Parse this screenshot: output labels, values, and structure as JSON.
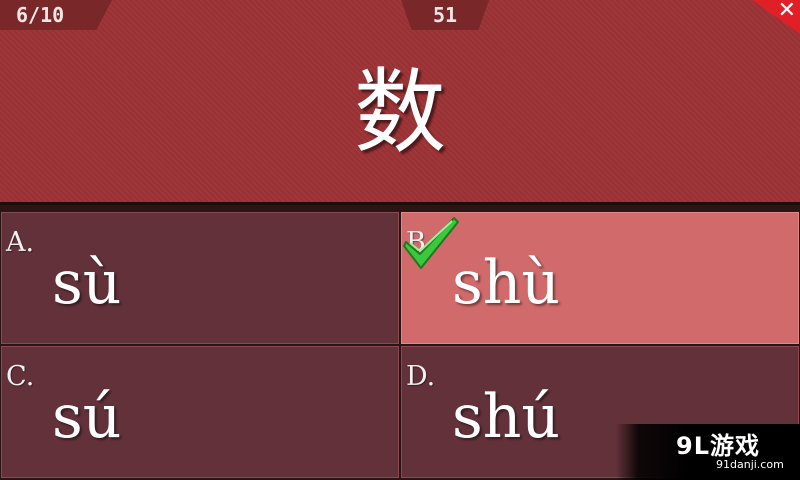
{
  "header": {
    "progress": "6/10",
    "timer": "51",
    "close_symbol": "✕",
    "character": "数"
  },
  "options": [
    {
      "letter": "A.",
      "text": "sù",
      "selected_correct": false
    },
    {
      "letter": "B.",
      "text": "shù",
      "selected_correct": true
    },
    {
      "letter": "C.",
      "text": "sú",
      "selected_correct": false
    },
    {
      "letter": "D.",
      "text": "shú",
      "selected_correct": false
    }
  ],
  "icons": {
    "close": "close-icon",
    "check": "checkmark-icon"
  },
  "watermark": {
    "logo": "9L游戏",
    "url": "91danji.com"
  },
  "colors": {
    "header": "#9c3235",
    "option_default": "#62313a",
    "option_correct": "#d06a6b",
    "close": "#e02026",
    "check": "#3cc83c"
  }
}
